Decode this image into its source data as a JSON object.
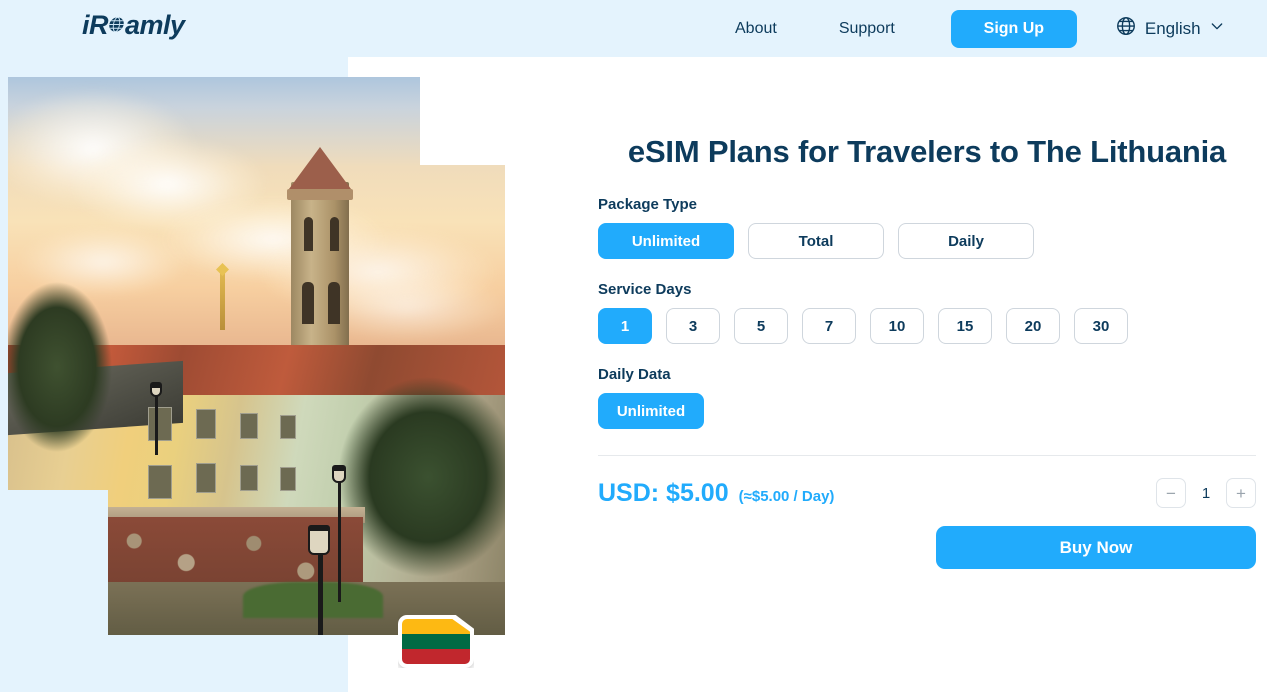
{
  "header": {
    "logo_text": "iRoamly",
    "logo_icon": "globe-icon",
    "nav": [
      {
        "label": "About"
      },
      {
        "label": "Support"
      }
    ],
    "signup_label": "Sign Up",
    "language": {
      "icon": "globe-icon",
      "label": "English",
      "chevron": "chevron-down-icon"
    },
    "background_color": "#e4f3fd"
  },
  "hero": {
    "image_alt": "Sunset view over old town buildings with church towers in Lithuania",
    "flag_badge": {
      "country": "Lithuania",
      "stripes": [
        "#FDB913",
        "#006A44",
        "#C1272D"
      ]
    }
  },
  "plan": {
    "title": "eSIM Plans for Travelers to The Lithuania",
    "package_type": {
      "label": "Package Type",
      "options": [
        "Unlimited",
        "Total",
        "Daily"
      ],
      "selected": "Unlimited"
    },
    "service_days": {
      "label": "Service Days",
      "options": [
        "1",
        "3",
        "5",
        "7",
        "10",
        "15",
        "20",
        "30"
      ],
      "selected": "1"
    },
    "daily_data": {
      "label": "Daily Data",
      "options": [
        "Unlimited"
      ],
      "selected": "Unlimited"
    },
    "price": {
      "main": "USD: $5.00",
      "per_day": "(≈$5.00 / Day)",
      "currency": "USD",
      "amount": "5.00",
      "daily_amount": "5.00"
    },
    "quantity": {
      "decrement_label": "−",
      "value": "1",
      "increment_label": "+"
    },
    "buy_label": "Buy Now"
  },
  "theme": {
    "accent": "#21abfc",
    "navy": "#0d3b5c",
    "light_blue_bg": "#e4f3fd",
    "border": "#cfd6dd"
  }
}
